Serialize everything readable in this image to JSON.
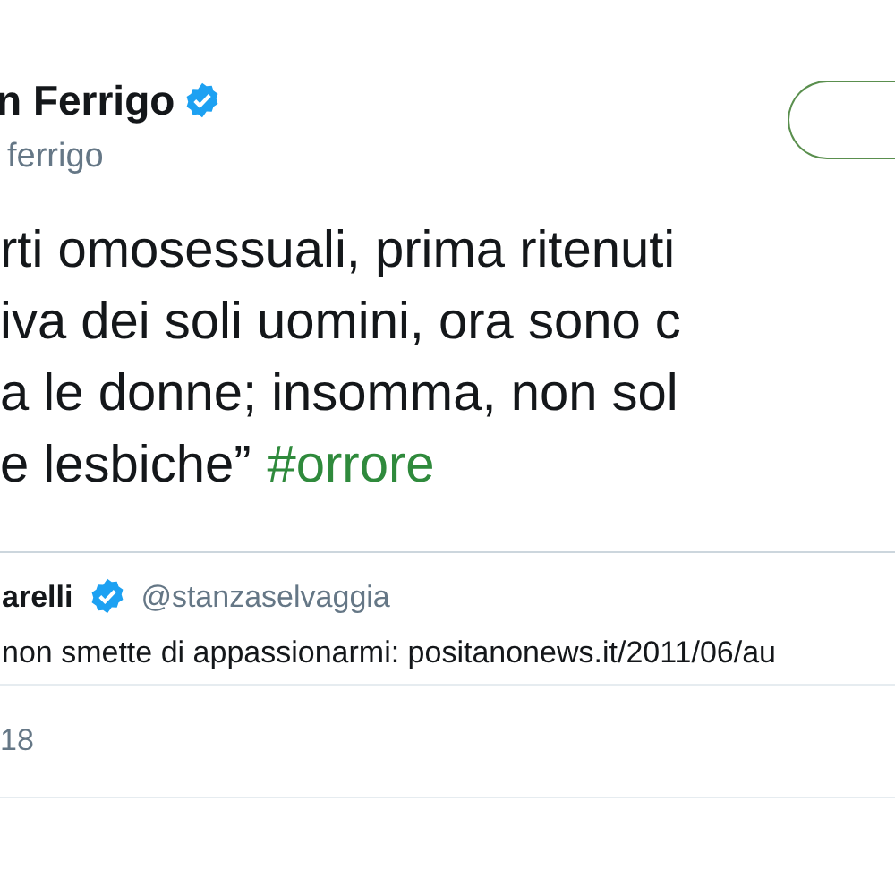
{
  "author": {
    "name": "n Ferrigo",
    "verified": true,
    "handle": "ferrigo"
  },
  "tweet": {
    "lines": [
      "rti omosessuali, prima ritenuti",
      "iva dei soli uomini, ora sono c",
      "a le donne; insomma, non sol"
    ],
    "last_line": "e lesbiche”",
    "hashtag": "#orrore"
  },
  "quoted": {
    "name": "arelli",
    "verified": true,
    "handle": "@stanzaselvaggia",
    "text": "non smette di appassionarmi: positanonews.it/2011/06/au"
  },
  "date": "18"
}
